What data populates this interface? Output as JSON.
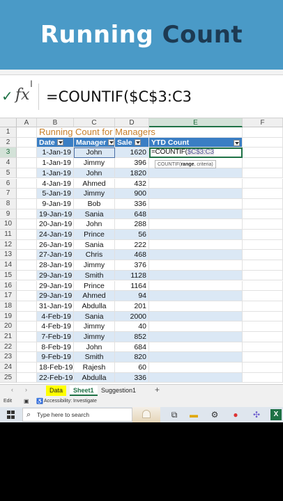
{
  "banner": {
    "title_part1": "Running",
    "title_part2": "Count"
  },
  "formula_bar": {
    "fx": "fx",
    "formula": "=COUNTIF($C$3:C3"
  },
  "columns": [
    "A",
    "B",
    "C",
    "D",
    "E",
    "F"
  ],
  "sheet_title": "Running Count for Managers",
  "table": {
    "headers": [
      "Date",
      "Manager",
      "Sale",
      "YTD Count"
    ],
    "rows": [
      [
        "1-Jan-19",
        "John",
        "1620"
      ],
      [
        "1-Jan-19",
        "Jimmy",
        "396"
      ],
      [
        "1-Jan-19",
        "John",
        "1820"
      ],
      [
        "4-Jan-19",
        "Ahmed",
        "432"
      ],
      [
        "5-Jan-19",
        "Jimmy",
        "900"
      ],
      [
        "9-Jan-19",
        "Bob",
        "336"
      ],
      [
        "19-Jan-19",
        "Sania",
        "648"
      ],
      [
        "20-Jan-19",
        "John",
        "288"
      ],
      [
        "24-Jan-19",
        "Prince",
        "56"
      ],
      [
        "26-Jan-19",
        "Sania",
        "222"
      ],
      [
        "27-Jan-19",
        "Chris",
        "468"
      ],
      [
        "28-Jan-19",
        "Jimmy",
        "376"
      ],
      [
        "29-Jan-19",
        "Smith",
        "1128"
      ],
      [
        "29-Jan-19",
        "Prince",
        "1164"
      ],
      [
        "29-Jan-19",
        "Ahmed",
        "94"
      ],
      [
        "31-Jan-19",
        "Abdulla",
        "201"
      ],
      [
        "4-Feb-19",
        "Sania",
        "2000"
      ],
      [
        "4-Feb-19",
        "Jimmy",
        "40"
      ],
      [
        "7-Feb-19",
        "Jimmy",
        "852"
      ],
      [
        "8-Feb-19",
        "John",
        "684"
      ],
      [
        "9-Feb-19",
        "Smith",
        "820"
      ],
      [
        "18-Feb-19",
        "Rajesh",
        "60"
      ],
      [
        "22-Feb-19",
        "Abdulla",
        "336"
      ]
    ],
    "editing": {
      "formula_prefix": "=COUNTIF(",
      "formula_ref": "$C$3:C3",
      "tooltip_fn": "COUNTIF(",
      "tooltip_arg1": "range",
      "tooltip_rest": ", criteria)"
    }
  },
  "sheet_tabs": {
    "tabs": [
      "Data",
      "Sheet1",
      "Suggestion1"
    ],
    "add": "+"
  },
  "status_bar": {
    "mode": "Edit",
    "accessibility": "Accessibility: Investigate"
  },
  "taskbar": {
    "search_placeholder": "Type here to search"
  },
  "colors": {
    "banner": "#4a9ac7",
    "header_fill": "#3a7ec4",
    "band_fill": "#dbe8f5",
    "excel_green": "#1e7145",
    "title_orange": "#c77f2a"
  }
}
